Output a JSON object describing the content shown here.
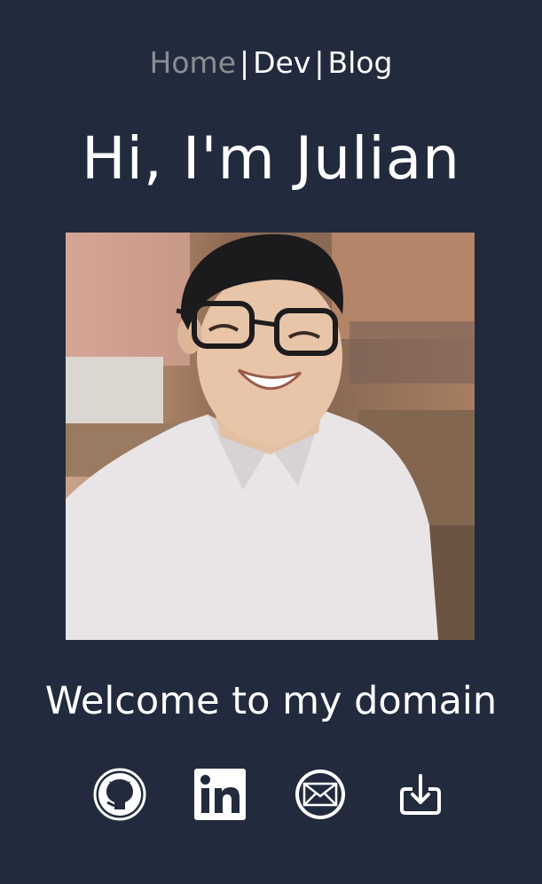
{
  "nav": {
    "items": [
      {
        "label": "Home",
        "active": true
      },
      {
        "label": "Dev",
        "active": false
      },
      {
        "label": "Blog",
        "active": false
      }
    ],
    "separator": "|"
  },
  "hero": {
    "title": "Hi, I'm Julian"
  },
  "welcome": "Welcome to my domain",
  "social": [
    {
      "icon": "github-icon"
    },
    {
      "icon": "linkedin-icon"
    },
    {
      "icon": "email-icon"
    },
    {
      "icon": "download-icon"
    }
  ],
  "colors": {
    "background": "#222b3d",
    "text": "#ffffff",
    "nav_active": "#8b8d92"
  }
}
